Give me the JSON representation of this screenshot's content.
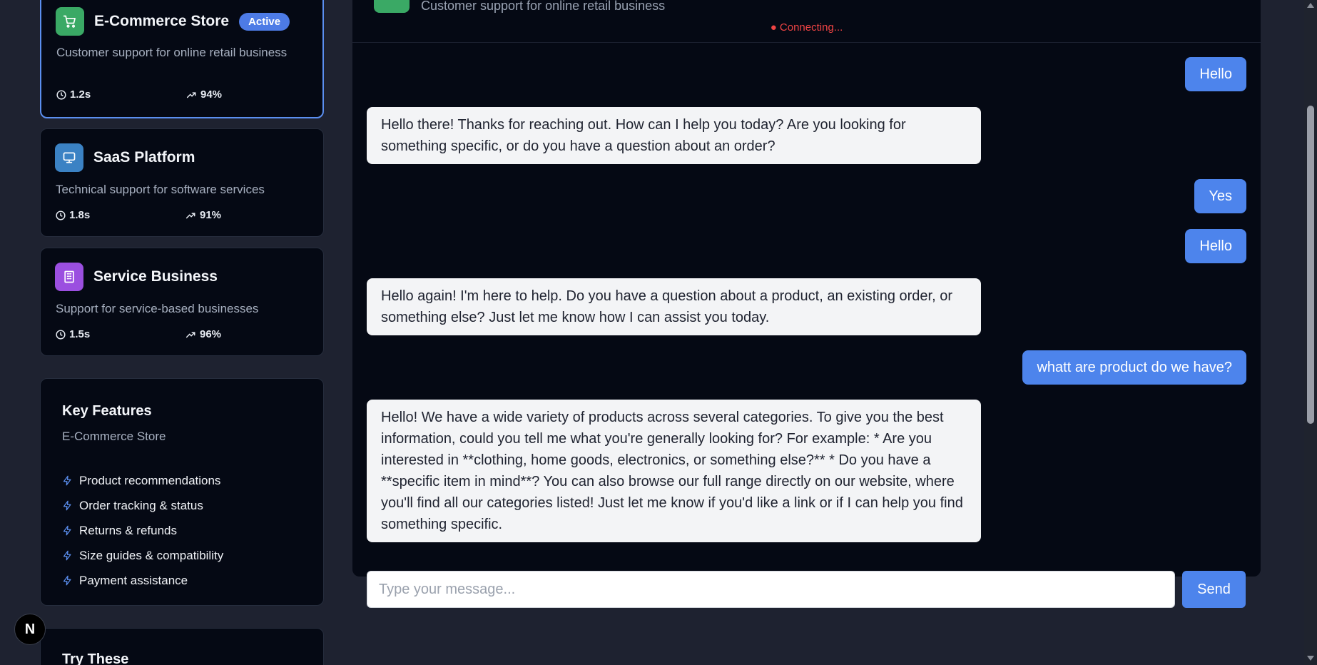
{
  "sidebar": {
    "businesses": [
      {
        "name": "E-Commerce Store",
        "badge": "Active",
        "description": "Customer support for online retail business",
        "response_time": "1.2s",
        "satisfaction": "94%",
        "icon": "cart-icon",
        "color": "#3aa965"
      },
      {
        "name": "SaaS Platform",
        "description": "Technical support for software services",
        "response_time": "1.8s",
        "satisfaction": "91%",
        "icon": "monitor-icon",
        "color": "#3b82c4"
      },
      {
        "name": "Service Business",
        "description": "Support for service-based businesses",
        "response_time": "1.5s",
        "satisfaction": "96%",
        "icon": "building-icon",
        "color": "#9b4fe0"
      }
    ],
    "features": {
      "title": "Key Features",
      "subtitle": "E-Commerce Store",
      "items": [
        "Product recommendations",
        "Order tracking & status",
        "Returns & refunds",
        "Size guides & compatibility",
        "Payment assistance"
      ]
    },
    "try_these": {
      "title": "Try These"
    }
  },
  "chat": {
    "header_description": "Customer support for online retail business",
    "status": "● Connecting...",
    "messages": [
      {
        "role": "user",
        "text": "Hello"
      },
      {
        "role": "bot",
        "text": "Hello there! Thanks for reaching out. How can I help you today? Are you looking for something specific, or do you have a question about an order?"
      },
      {
        "role": "user",
        "text": "Yes"
      },
      {
        "role": "user",
        "text": "Hello"
      },
      {
        "role": "bot",
        "text": "Hello again! I'm here to help. Do you have a question about a product, an existing order, or something else? Just let me know how I can assist you today."
      },
      {
        "role": "user",
        "text": "whatt are product do we have?"
      },
      {
        "role": "bot",
        "text": "Hello! We have a wide variety of products across several categories. To give you the best information, could you tell me what you're generally looking for? For example: * Are you interested in **clothing, home goods, electronics, or something else?** * Do you have a **specific item in mind**? You can also browse our full range directly on our website, where you'll find all our categories listed! Just let me know if you'd like a link or if I can help you find something specific."
      }
    ],
    "input_placeholder": "Type your message...",
    "send_label": "Send"
  },
  "logo": {
    "letter": "N"
  },
  "colors": {
    "accent": "#4d84ec",
    "background": "#1e2230",
    "panel": "#050914",
    "status_error": "#ef4444"
  }
}
